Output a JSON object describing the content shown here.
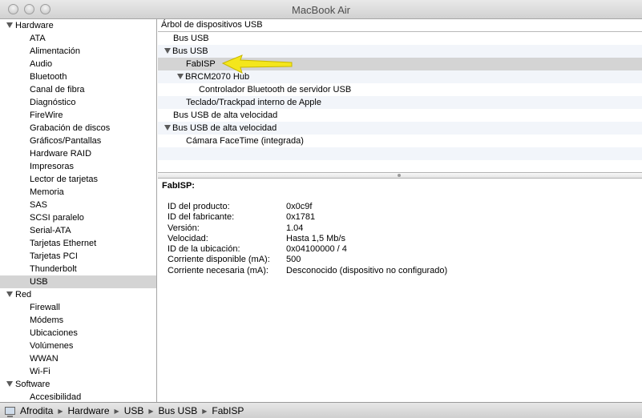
{
  "window": {
    "title": "MacBook Air"
  },
  "sidebar": {
    "rows": [
      {
        "kind": "category",
        "label": "Hardware"
      },
      {
        "kind": "item",
        "label": "ATA"
      },
      {
        "kind": "item",
        "label": "Alimentación"
      },
      {
        "kind": "item",
        "label": "Audio"
      },
      {
        "kind": "item",
        "label": "Bluetooth"
      },
      {
        "kind": "item",
        "label": "Canal de fibra"
      },
      {
        "kind": "item",
        "label": "Diagnóstico"
      },
      {
        "kind": "item",
        "label": "FireWire"
      },
      {
        "kind": "item",
        "label": "Grabación de discos"
      },
      {
        "kind": "item",
        "label": "Gráficos/Pantallas"
      },
      {
        "kind": "item",
        "label": "Hardware RAID"
      },
      {
        "kind": "item",
        "label": "Impresoras"
      },
      {
        "kind": "item",
        "label": "Lector de tarjetas"
      },
      {
        "kind": "item",
        "label": "Memoria"
      },
      {
        "kind": "item",
        "label": "SAS"
      },
      {
        "kind": "item",
        "label": "SCSI paralelo"
      },
      {
        "kind": "item",
        "label": "Serial-ATA"
      },
      {
        "kind": "item",
        "label": "Tarjetas Ethernet"
      },
      {
        "kind": "item",
        "label": "Tarjetas PCI"
      },
      {
        "kind": "item",
        "label": "Thunderbolt"
      },
      {
        "kind": "item",
        "label": "USB",
        "selected": true
      },
      {
        "kind": "category",
        "label": "Red"
      },
      {
        "kind": "item",
        "label": "Firewall"
      },
      {
        "kind": "item",
        "label": "Módems"
      },
      {
        "kind": "item",
        "label": "Ubicaciones"
      },
      {
        "kind": "item",
        "label": "Volúmenes"
      },
      {
        "kind": "item",
        "label": "WWAN"
      },
      {
        "kind": "item",
        "label": "Wi-Fi"
      },
      {
        "kind": "category",
        "label": "Software"
      },
      {
        "kind": "item",
        "label": "Accesibilidad"
      }
    ]
  },
  "tree": {
    "header": "Árbol de dispositivos USB",
    "rows": [
      {
        "label": "Bus USB",
        "level": 0,
        "expandable": false
      },
      {
        "label": "Bus USB",
        "level": 0,
        "expandable": true
      },
      {
        "label": "FabISP",
        "level": 1,
        "expandable": false,
        "selected": true
      },
      {
        "label": "BRCM2070 Hub",
        "level": 1,
        "expandable": true
      },
      {
        "label": "Controlador Bluetooth de servidor USB",
        "level": 2,
        "expandable": false
      },
      {
        "label": "Teclado/Trackpad interno de Apple",
        "level": 1,
        "expandable": false
      },
      {
        "label": "Bus USB de alta velocidad",
        "level": 0,
        "expandable": false
      },
      {
        "label": "Bus USB de alta velocidad",
        "level": 0,
        "expandable": true
      },
      {
        "label": "Cámara FaceTime (integrada)",
        "level": 1,
        "expandable": false
      }
    ]
  },
  "detail": {
    "title": "FabISP:",
    "props": [
      {
        "key": "ID del producto:",
        "value": "0x0c9f"
      },
      {
        "key": "ID del fabricante:",
        "value": "0x1781"
      },
      {
        "key": "Versión:",
        "value": "1.04"
      },
      {
        "key": "Velocidad:",
        "value": "Hasta 1,5 Mb/s"
      },
      {
        "key": "ID de la ubicación:",
        "value": "0x04100000 / 4"
      },
      {
        "key": "Corriente disponible (mA):",
        "value": "500"
      },
      {
        "key": "Corriente necesaria (mA):",
        "value": "Desconocido (dispositivo no configurado)"
      }
    ]
  },
  "breadcrumb": [
    "Afrodita",
    "Hardware",
    "USB",
    "Bus USB",
    "FabISP"
  ],
  "colors": {
    "arrow": "#f4e61c",
    "arrow_outline": "#c9b800",
    "selection": "#d4d4d4"
  }
}
